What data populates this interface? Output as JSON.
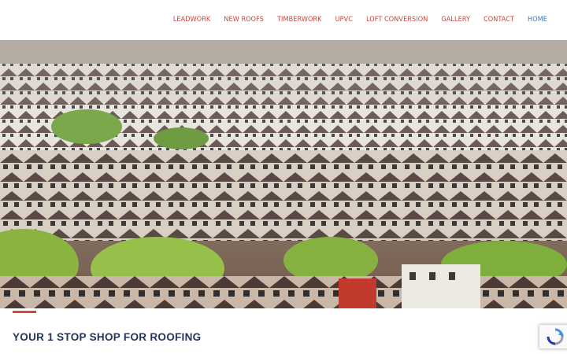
{
  "nav": {
    "items": [
      {
        "label": "LEADWORK"
      },
      {
        "label": "NEW ROOFS"
      },
      {
        "label": "TIMBERWORK"
      },
      {
        "label": "UPVC"
      },
      {
        "label": "LOFT CONVERSION"
      },
      {
        "label": "GALLERY"
      },
      {
        "label": "CONTACT"
      },
      {
        "label": "HOME",
        "active": true
      }
    ]
  },
  "hero": {
    "image": "hillside-terraced-houses-photo"
  },
  "main": {
    "tagline": "YOUR 1 STOP SHOP FOR ROOFING"
  },
  "widgets": {
    "recaptcha_icon": "recaptcha-icon"
  },
  "colors": {
    "nav_link": "#c8463a",
    "nav_active": "#2f7bbf",
    "accent": "#d5463a",
    "tagline": "#25345a"
  }
}
